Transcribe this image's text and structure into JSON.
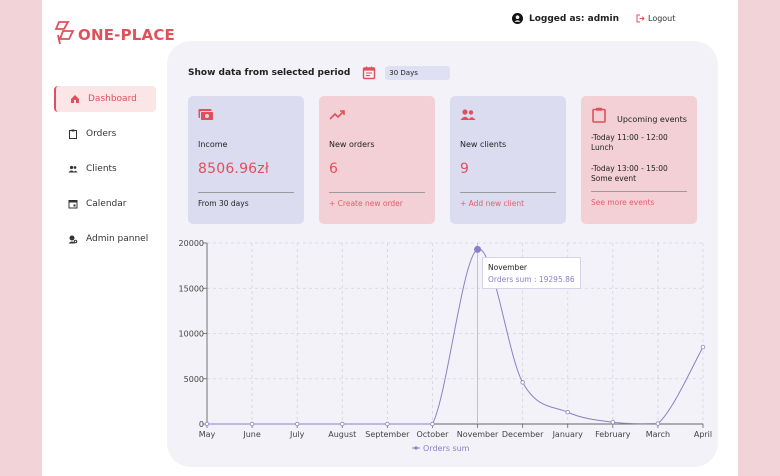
{
  "app": {
    "logo_text": "ONE-PLACE",
    "brand_color": "#e0505a"
  },
  "header": {
    "user_label": "Logged as: admin",
    "logout_label": "Logout"
  },
  "sidebar": {
    "items": [
      {
        "label": "Dashboard",
        "icon": "home-icon",
        "active": true
      },
      {
        "label": "Orders",
        "icon": "clipboard-icon",
        "active": false
      },
      {
        "label": "Clients",
        "icon": "people-icon",
        "active": false
      },
      {
        "label": "Calendar",
        "icon": "calendar-icon",
        "active": false
      },
      {
        "label": "Admin pannel",
        "icon": "admin-gear-icon",
        "active": false
      }
    ]
  },
  "period": {
    "label": "Show data from selected period",
    "selected": "30 Days"
  },
  "cards": {
    "income": {
      "title": "Income",
      "value": "8506.96zł",
      "footer": "From 30 days"
    },
    "orders": {
      "title": "New orders",
      "value": "6",
      "link": "+ Create new order"
    },
    "clients": {
      "title": "New clients",
      "value": "9",
      "link": "+ Add new client"
    },
    "events": {
      "title": "Upcoming events",
      "items": [
        {
          "line1": "-Today 11:00 - 12:00",
          "line2": "Lunch"
        },
        {
          "line1": "-Today 13:00 - 15:00",
          "line2": "Some event"
        }
      ],
      "link": "See more events"
    }
  },
  "tooltip": {
    "title": "November",
    "text": "Orders sum : 19295.86"
  },
  "chart_data": {
    "type": "line",
    "categories": [
      "May",
      "June",
      "July",
      "August",
      "September",
      "October",
      "November",
      "December",
      "January",
      "February",
      "March",
      "April"
    ],
    "series": [
      {
        "name": "Orders sum",
        "values": [
          0,
          0,
          0,
          0,
          0,
          0,
          19295.86,
          4600,
          1300,
          200,
          50,
          8500
        ],
        "color": "#8a80c8"
      }
    ],
    "ylim": [
      0,
      20000
    ],
    "yticks": [
      0,
      5000,
      10000,
      15000,
      20000
    ],
    "grid": true,
    "legend": "bottom"
  }
}
